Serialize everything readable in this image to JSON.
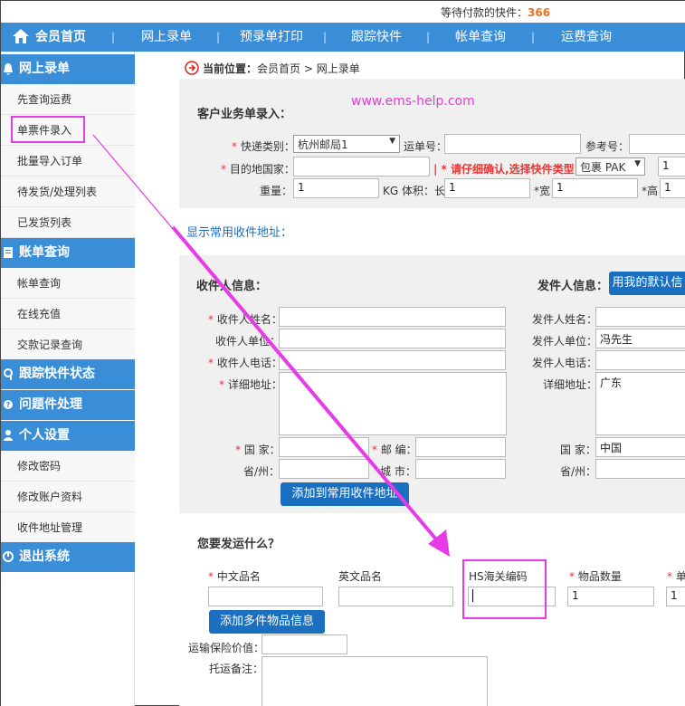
{
  "topbar": {
    "pending_label": "等待付款的快件：",
    "pending_count": "366"
  },
  "nav": {
    "home": "会员首页",
    "items": [
      "网上录单",
      "预录单打印",
      "跟踪快件",
      "帐单查询",
      "运费查询"
    ]
  },
  "sidebar": {
    "groups": [
      {
        "title": "网上录单",
        "items": [
          "先查询运费",
          "单票件录入",
          "批量导入订单",
          "待发货/处理列表",
          "已发货列表"
        ]
      },
      {
        "title": "账单查询",
        "items": [
          "帐单查询",
          "在线充值",
          "交款记录查询"
        ]
      },
      {
        "title": "跟踪快件状态",
        "items": []
      },
      {
        "title": "问题件处理",
        "items": []
      },
      {
        "title": "个人设置",
        "items": [
          "修改密码",
          "修改账户资料",
          "收件地址管理"
        ]
      },
      {
        "title": "退出系统",
        "items": []
      }
    ]
  },
  "breadcrumb": {
    "label": "当前位置：",
    "path": "会员首页 > 网上录单"
  },
  "watermark": "www.ems-help.com",
  "order_form": {
    "title": "客户业务单录入：",
    "courier_type_label": "快递类别：",
    "courier_type_value": "杭州邮局1",
    "waybill_label": "运单号：",
    "reference_label": "参考号：",
    "destination_label": "目的地国家：",
    "warning": "请仔细确认,选择快件类型：",
    "package_type": "包裹 PAK",
    "package_qty": "1",
    "weight_label": "重量：",
    "weight_value": "1",
    "volume_label": "KG 体积：长",
    "length_value": "1",
    "width_label": "*宽",
    "width_value": "1",
    "height_label": "*高",
    "height_value": "1"
  },
  "address_link": "显示常用收件地址：",
  "recipient": {
    "title": "收件人信息：",
    "name_label": "收件人姓名：",
    "company_label": "收件人单位：",
    "phone_label": "收件人电话：",
    "address_label": "详细地址：",
    "country_label": "国 家：",
    "zip_label": "邮 编：",
    "province_label": "省/州：",
    "city_label": "城 市：",
    "add_button": "添加到常用收件地址"
  },
  "sender": {
    "title": "发件人信息：",
    "default_button": "用我的默认信",
    "name_label": "发件人姓名：",
    "company_label": "发件人单位：",
    "company_value": "冯先生",
    "phone_label": "发件人电话：",
    "address_label": "详细地址：",
    "address_value": "广东",
    "country_label": "国 家：",
    "country_value": "中国",
    "province_label": "省/州："
  },
  "goods": {
    "title": "您要发运什么？",
    "cn_name_label": "中文品名",
    "en_name_label": "英文品名",
    "hs_label": "HS海关编码",
    "qty_label": "物品数量",
    "qty_value": "1",
    "unit_label": "单",
    "unit_value": "1",
    "add_button": "添加多件物品信息",
    "insurance_label": "运输保险价值：",
    "remark_label": "托运备注："
  },
  "colors": {
    "nav_blue": "#3a8ed8",
    "button_blue": "#1b6fc0",
    "callout": "#e63be6",
    "count": "#e8711c"
  }
}
